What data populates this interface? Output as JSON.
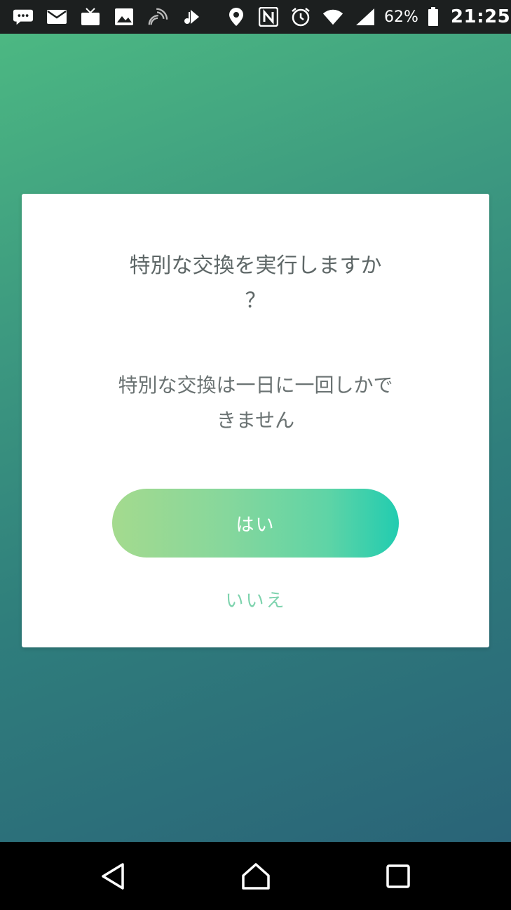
{
  "status_bar": {
    "left_icons": [
      "chat-icon",
      "mail-icon",
      "tv-icon",
      "image-icon",
      "satellite-icon",
      "music-share-icon"
    ],
    "right_icons": [
      "location-icon",
      "nfc-icon",
      "alarm-icon",
      "wifi-icon",
      "signal-icon",
      "battery-icon"
    ],
    "battery": "62%",
    "time": "21:25"
  },
  "dialog": {
    "title_line1": "特別な交換を実行しますか",
    "title_line2": "？",
    "message_line1": "特別な交換は一日に一回しかで",
    "message_line2": "きません",
    "yes_label": "はい",
    "no_label": "いいえ"
  },
  "nav_bar": {
    "buttons": [
      "back-icon",
      "home-icon",
      "recents-icon"
    ]
  },
  "colors": {
    "background_top": "#4cb882",
    "background_bottom": "#2a6478",
    "button_gradient_start": "#a4da8e",
    "button_gradient_end": "#22ccb0",
    "no_text": "#7ed3ae",
    "text_gray": "#5e6767"
  }
}
